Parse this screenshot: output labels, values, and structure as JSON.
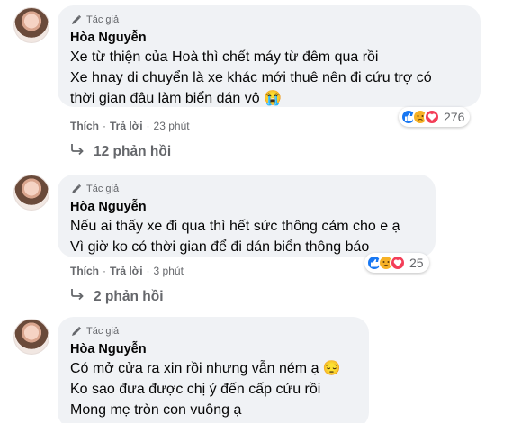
{
  "comments": [
    {
      "badge_label": "Tác giả",
      "author": "Hòa Nguyễn",
      "lines": [
        "Xe từ thiện của Hoà thì chết máy từ đêm qua rồi",
        "Xe hnay di chuyển là xe khác mới thuê nên đi cứu trợ có",
        "thời gian đâu làm biển dán vô 😭"
      ],
      "like_label": "Thích",
      "reply_label": "Trả lời",
      "time": "23 phút",
      "reaction_count": "276",
      "reactions": [
        "like",
        "sad",
        "love"
      ],
      "replies_label": "12 phản hồi"
    },
    {
      "badge_label": "Tác giả",
      "author": "Hòa Nguyễn",
      "lines": [
        "Nếu ai thấy xe đi qua thì hết sức thông cảm cho e ạ",
        "Vì giờ ko có thời gian để đi dán biển thông báo"
      ],
      "like_label": "Thích",
      "reply_label": "Trả lời",
      "time": "3 phút",
      "reaction_count": "25",
      "reactions": [
        "like",
        "sad",
        "love"
      ],
      "replies_label": "2 phản hồi"
    },
    {
      "badge_label": "Tác giả",
      "author": "Hòa Nguyễn",
      "lines": [
        "Có mở cửa ra xin rồi nhưng vẫn ném ạ 😔",
        "Ko sao đưa được chị ý đến cấp cứu rồi",
        "Mong mẹ tròn con vuông ạ"
      ]
    }
  ],
  "separator": "·",
  "colors": {
    "bubble": "#f0f2f5",
    "meta_text": "#65676b",
    "like": "#1877f2",
    "sad": "#f7b125",
    "love": "#f33e58"
  }
}
